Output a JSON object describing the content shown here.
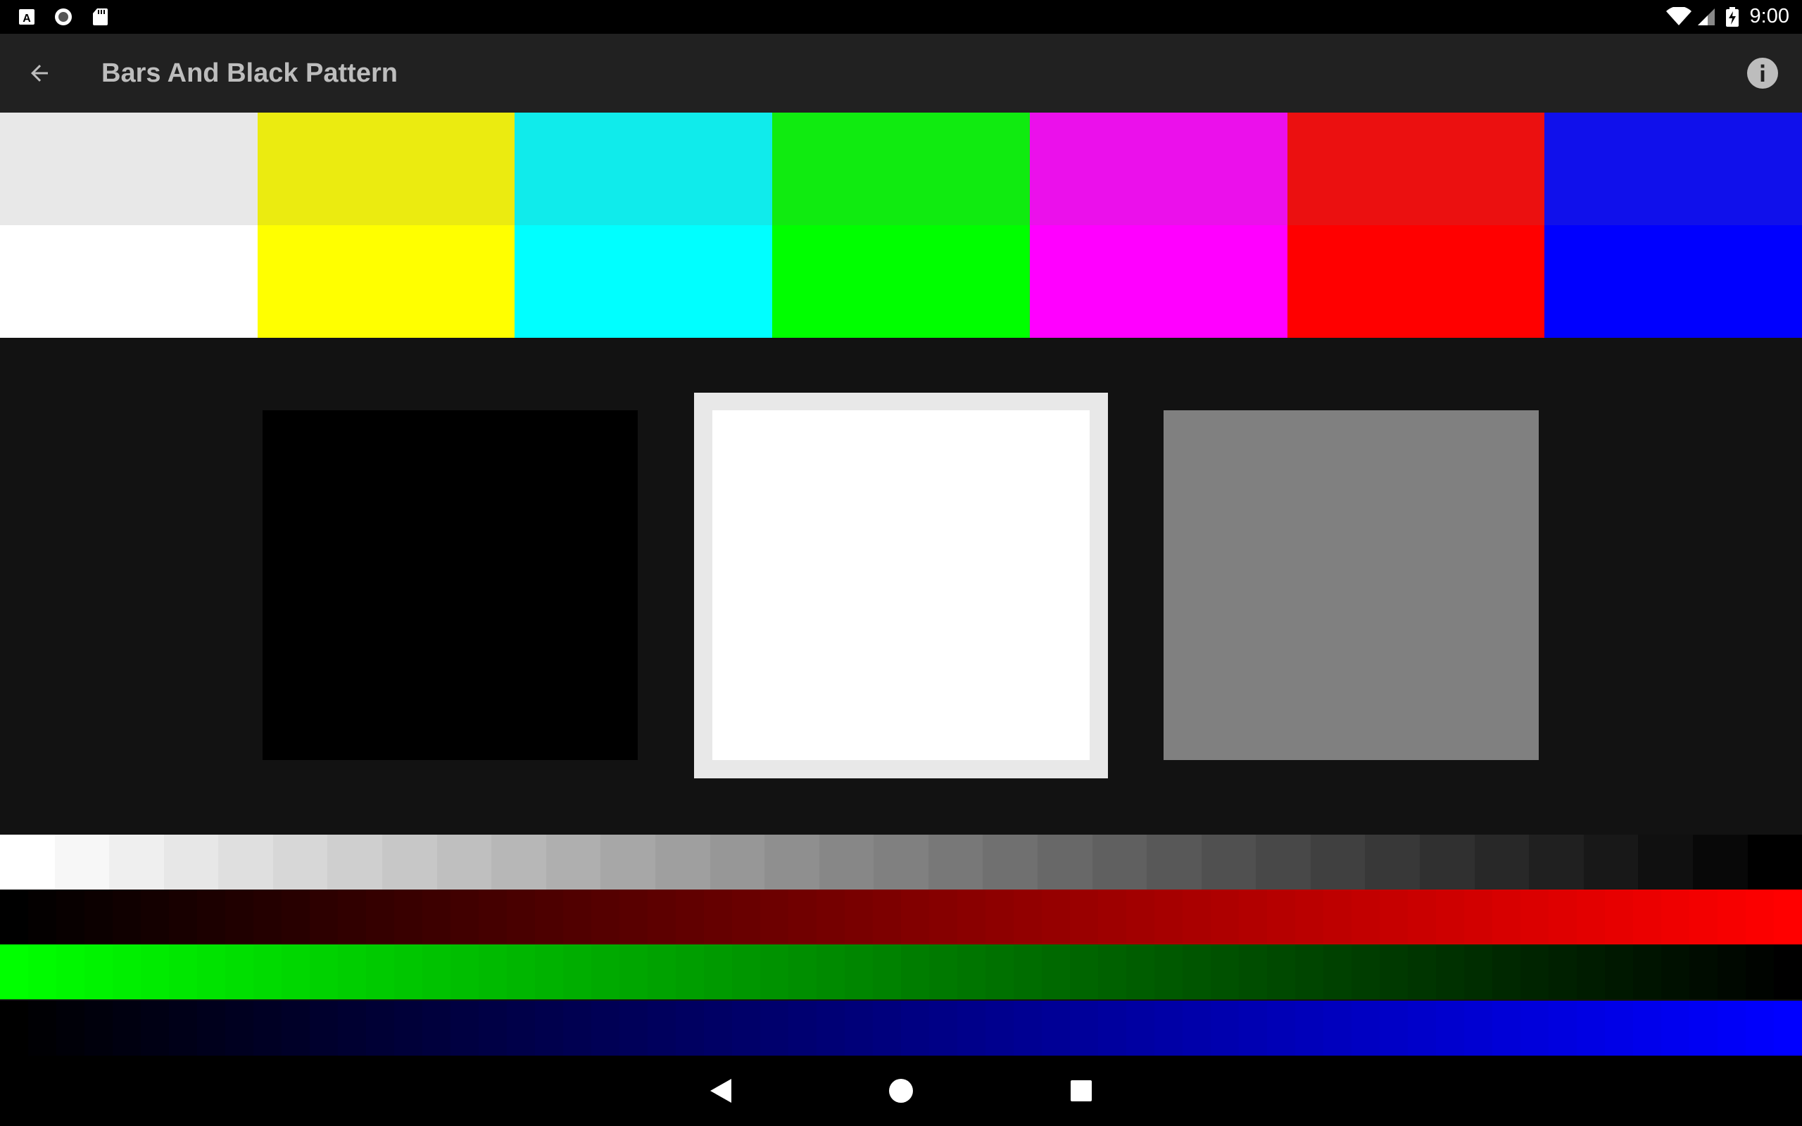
{
  "status_bar": {
    "time": "9:00",
    "left_icons": [
      "accessibility-icon",
      "record-icon",
      "sd-card-icon"
    ],
    "right_icons": [
      "wifi-icon",
      "cell-signal-icon",
      "battery-charging-icon"
    ]
  },
  "app_bar": {
    "title": "Bars And Black Pattern",
    "back_icon": "arrow-back-icon",
    "info_icon": "info-icon",
    "background": "#212121",
    "title_color": "#bdbdbd"
  },
  "color_bars": [
    {
      "name": "white",
      "top": "#e8e8e8",
      "bottom": "#ffffff"
    },
    {
      "name": "yellow",
      "top": "#ebeb10",
      "bottom": "#ffff00"
    },
    {
      "name": "cyan",
      "top": "#10ebeb",
      "bottom": "#00ffff"
    },
    {
      "name": "green",
      "top": "#10eb10",
      "bottom": "#00ff00"
    },
    {
      "name": "magenta",
      "top": "#eb10eb",
      "bottom": "#ff00ff"
    },
    {
      "name": "red",
      "top": "#eb1010",
      "bottom": "#ff0000"
    },
    {
      "name": "blue",
      "top": "#1010eb",
      "bottom": "#0000ff"
    }
  ],
  "squares": [
    {
      "name": "black",
      "color": "#000000"
    },
    {
      "name": "white",
      "color": "#ffffff",
      "frame": "#e8e8e8"
    },
    {
      "name": "gray",
      "color": "#808080"
    }
  ],
  "grayscale_steps": 33,
  "ramps": [
    {
      "name": "red",
      "from": "#000000",
      "to": "#ff0000"
    },
    {
      "name": "green",
      "from": "#00ff00",
      "to": "#000000"
    },
    {
      "name": "blue",
      "from": "#000000",
      "to": "#0000ff"
    }
  ],
  "nav_bar": {
    "icons": [
      "back-triangle-icon",
      "home-circle-icon",
      "recents-square-icon"
    ]
  }
}
